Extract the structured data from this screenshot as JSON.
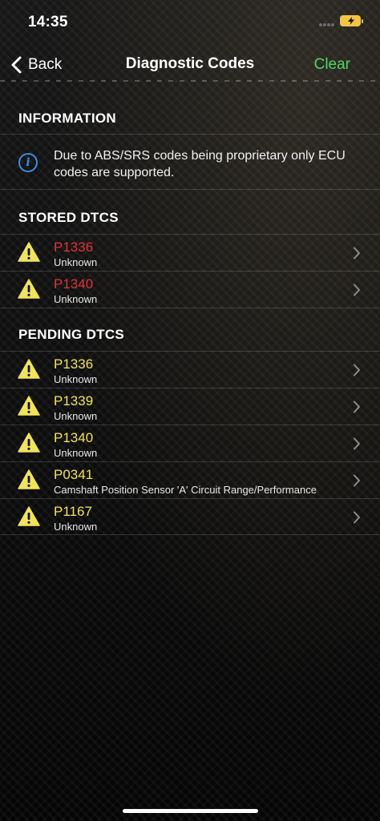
{
  "status_bar": {
    "time": "14:35"
  },
  "nav": {
    "back_label": "Back",
    "title": "Diagnostic Codes",
    "clear_label": "Clear"
  },
  "colors": {
    "stored": "#e0353a",
    "pending": "#f1e35a",
    "accent": "#4cd964",
    "info": "#3a8ee6"
  },
  "information": {
    "header": "INFORMATION",
    "icon": "info-icon",
    "message": "Due to ABS/SRS codes being proprietary only ECU codes are supported."
  },
  "stored": {
    "header": "STORED DTCS",
    "items": [
      {
        "code": "P1336",
        "desc": "Unknown"
      },
      {
        "code": "P1340",
        "desc": "Unknown"
      }
    ]
  },
  "pending": {
    "header": "PENDING DTCS",
    "items": [
      {
        "code": "P1336",
        "desc": "Unknown"
      },
      {
        "code": "P1339",
        "desc": "Unknown"
      },
      {
        "code": "P1340",
        "desc": "Unknown"
      },
      {
        "code": "P0341",
        "desc": "Camshaft Position Sensor 'A' Circuit Range/Performance"
      },
      {
        "code": "P1167",
        "desc": "Unknown"
      }
    ]
  }
}
